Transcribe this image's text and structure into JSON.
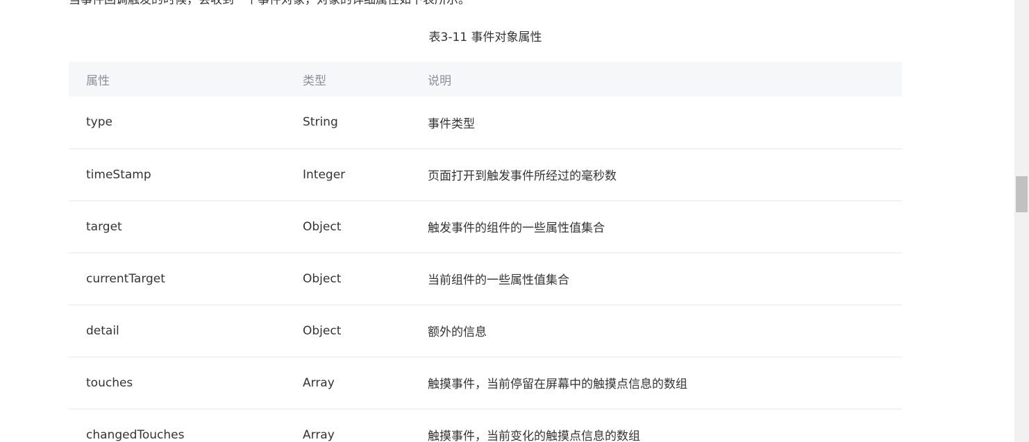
{
  "intro_text": "当事件回调触发的时候，会收到一个事件对象，对象的详细属性如下表所示。",
  "caption": "表3-11 事件对象属性",
  "table": {
    "headers": [
      "属性",
      "类型",
      "说明"
    ],
    "rows": [
      [
        "type",
        "String",
        "事件类型"
      ],
      [
        "timeStamp",
        "Integer",
        "页面打开到触发事件所经过的毫秒数"
      ],
      [
        "target",
        "Object",
        "触发事件的组件的一些属性值集合"
      ],
      [
        "currentTarget",
        "Object",
        "当前组件的一些属性值集合"
      ],
      [
        "detail",
        "Object",
        "额外的信息"
      ],
      [
        "touches",
        "Array",
        "触摸事件，当前停留在屏幕中的触摸点信息的数组"
      ],
      [
        "changedTouches",
        "Array",
        "触摸事件，当前变化的触摸点信息的数组"
      ]
    ]
  },
  "colors": {
    "header_bg": "#f6f7f9",
    "header_text": "#8a8f99",
    "body_text": "#333333",
    "divider": "#e8e8e8"
  }
}
